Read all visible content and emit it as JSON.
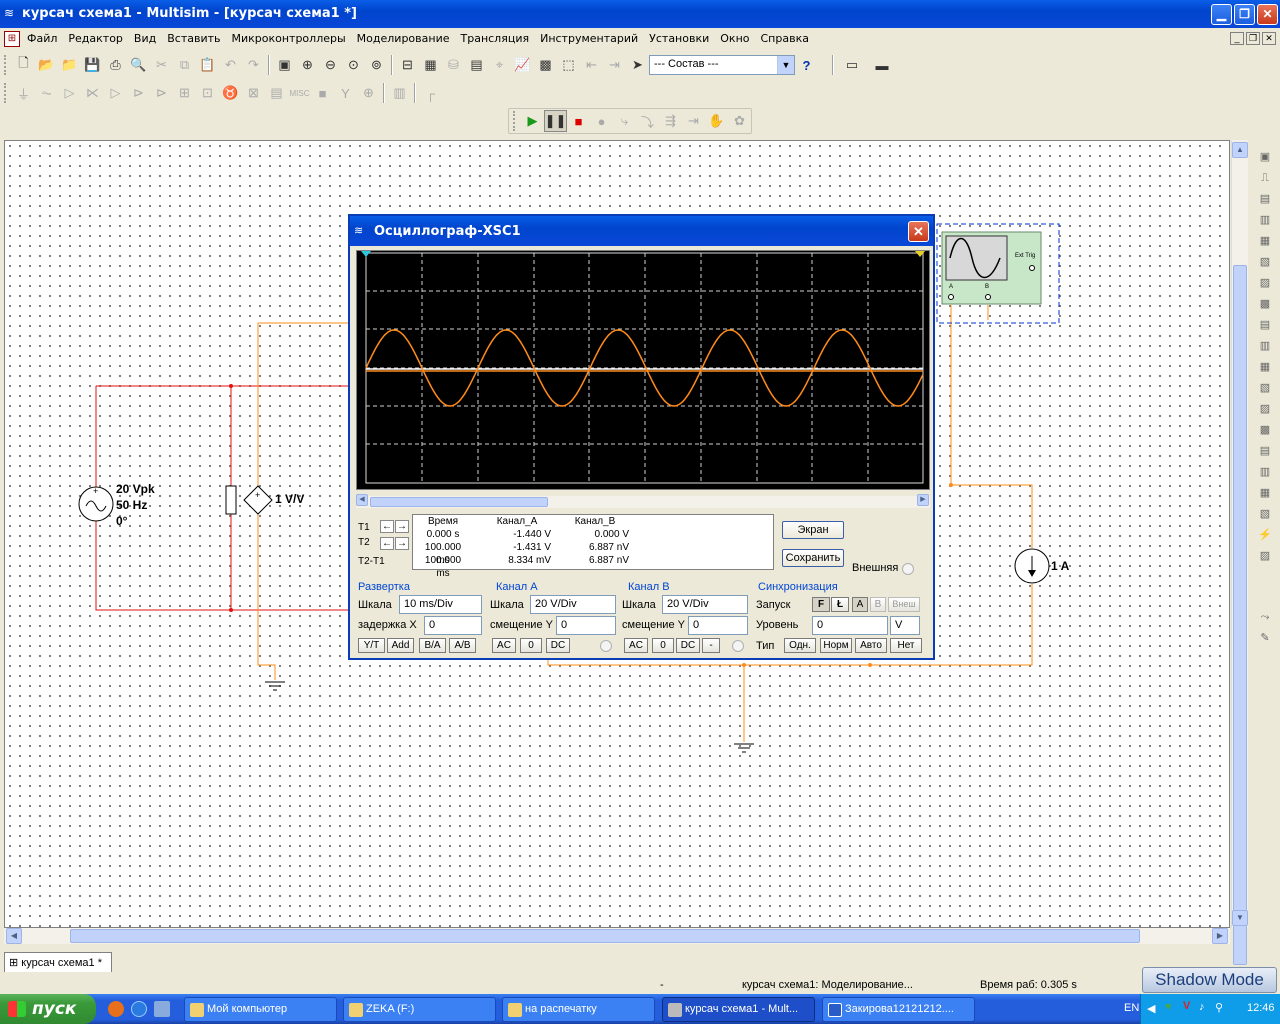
{
  "window": {
    "title": "курсач схема1 - Multisim - [курсач схема1 *]",
    "min_label": "▁",
    "max_label": "❐",
    "close_label": "✕"
  },
  "menu": [
    "Файл",
    "Редактор",
    "Вид",
    "Вставить",
    "Микроконтроллеры",
    "Моделирование",
    "Трансляция",
    "Инструментарий",
    "Установки",
    "Окно",
    "Справка"
  ],
  "toolbar": {
    "combo_value": "--- Состав ---",
    "help_icon": "?"
  },
  "circuit": {
    "source": {
      "amp": "20 Vpk",
      "freq": "50 Hz",
      "phase": "0°"
    },
    "vcvs_label": "1 V/V",
    "current_source_label": "1 A",
    "scope_ext_trig": "Ext Trig",
    "scope_a": "A",
    "scope_b": "B"
  },
  "scope": {
    "title": "Осциллограф-XSC1",
    "close": "✕",
    "t1": "T1",
    "t2": "T2",
    "t2t1": "T2-T1",
    "readout": {
      "headers": [
        "Время",
        "Канал_A",
        "Канал_B"
      ],
      "time": [
        "0.000 s",
        "100.000 ms",
        "100.000 ms"
      ],
      "chA": [
        "-1.440 V",
        "-1.431 V",
        "8.334 mV"
      ],
      "chB": [
        "0.000 V",
        "6.887 nV",
        "6.887 nV"
      ]
    },
    "btn_screen": "Экран",
    "btn_save": "Сохранить",
    "external": "Внешняя",
    "sweep": {
      "title": "Развертка",
      "scale_label": "Шкала",
      "scale_value": "10 ms/Div",
      "delay_label": "задержка X",
      "delay_value": "0",
      "buttons": [
        "Y/T",
        "Add",
        "B/A",
        "A/B"
      ]
    },
    "chanA": {
      "title": "Канал A",
      "scale_label": "Шкала",
      "scale_value": "20  V/Div",
      "offset_label": "смещение Y",
      "offset_value": "0",
      "buttons": [
        "AC",
        "0",
        "DC"
      ]
    },
    "chanB": {
      "title": "Канал B",
      "scale_label": "Шкала",
      "scale_value": "20  V/Div",
      "offset_label": "смещение Y",
      "offset_value": "0",
      "buttons": [
        "AC",
        "0",
        "DC",
        "-"
      ]
    },
    "sync": {
      "title": "Синхронизация",
      "trigger_label": "Запуск",
      "edge_rise": "F",
      "edge_fall": "Ł",
      "src_a": "A",
      "src_b": "B",
      "src_ext": "Внеш",
      "level_label": "Уровень",
      "level_value": "0",
      "level_unit": "V",
      "type_label": "Тип",
      "types": [
        "Одн.",
        "Норм",
        "Авто",
        "Нет"
      ]
    },
    "trace_color": "#ff8c1a"
  },
  "doc_tab": "курсач схема1 *",
  "status": {
    "dash": "-",
    "sim": "курсач схема1: Моделирование...",
    "runtime": "Время раб: 0.305 s",
    "shadow_mode": "Shadow Mode"
  },
  "taskbar": {
    "start": "пуск",
    "tasks": [
      "Мой компьютер",
      "ZEKA (F:)",
      "на распечатку",
      "курсач схема1 - Mult...",
      "Закирова12121212...."
    ],
    "lang": "EN",
    "clock": "12:46"
  }
}
